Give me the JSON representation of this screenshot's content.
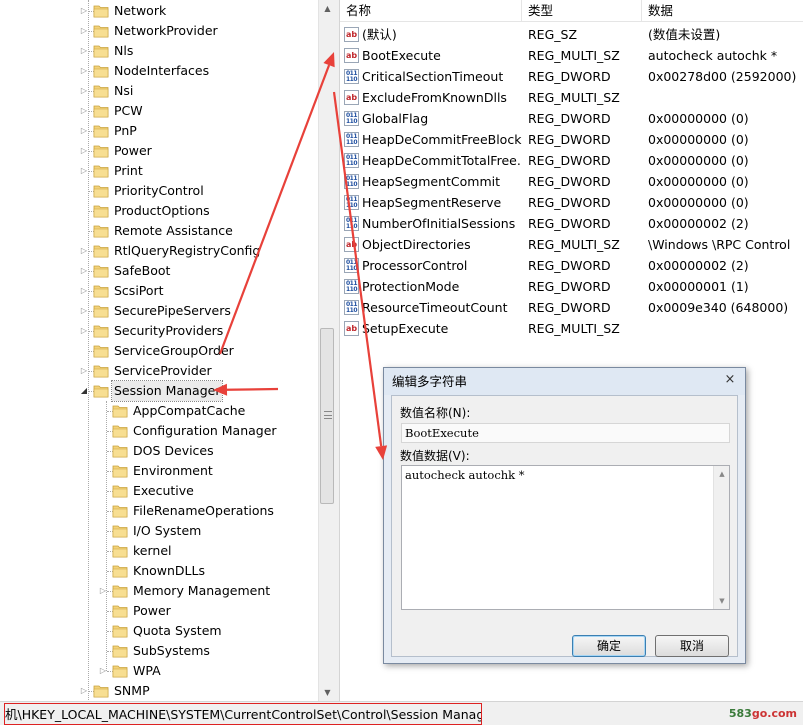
{
  "tree": {
    "items": [
      {
        "label": "Network",
        "level": 0,
        "expander": "collapsed"
      },
      {
        "label": "NetworkProvider",
        "level": 0,
        "expander": "collapsed"
      },
      {
        "label": "Nls",
        "level": 0,
        "expander": "collapsed"
      },
      {
        "label": "NodeInterfaces",
        "level": 0,
        "expander": "collapsed"
      },
      {
        "label": "Nsi",
        "level": 0,
        "expander": "collapsed"
      },
      {
        "label": "PCW",
        "level": 0,
        "expander": "collapsed"
      },
      {
        "label": "PnP",
        "level": 0,
        "expander": "collapsed"
      },
      {
        "label": "Power",
        "level": 0,
        "expander": "collapsed"
      },
      {
        "label": "Print",
        "level": 0,
        "expander": "collapsed"
      },
      {
        "label": "PriorityControl",
        "level": 0,
        "expander": "none"
      },
      {
        "label": "ProductOptions",
        "level": 0,
        "expander": "none"
      },
      {
        "label": "Remote Assistance",
        "level": 0,
        "expander": "none"
      },
      {
        "label": "RtlQueryRegistryConfig",
        "level": 0,
        "expander": "collapsed"
      },
      {
        "label": "SafeBoot",
        "level": 0,
        "expander": "collapsed"
      },
      {
        "label": "ScsiPort",
        "level": 0,
        "expander": "collapsed"
      },
      {
        "label": "SecurePipeServers",
        "level": 0,
        "expander": "collapsed"
      },
      {
        "label": "SecurityProviders",
        "level": 0,
        "expander": "collapsed"
      },
      {
        "label": "ServiceGroupOrder",
        "level": 0,
        "expander": "none"
      },
      {
        "label": "ServiceProvider",
        "level": 0,
        "expander": "collapsed"
      },
      {
        "label": "Session Manager",
        "level": 0,
        "expander": "expanded",
        "selected": true
      },
      {
        "label": "AppCompatCache",
        "level": 1,
        "expander": "none"
      },
      {
        "label": "Configuration Manager",
        "level": 1,
        "expander": "none"
      },
      {
        "label": "DOS Devices",
        "level": 1,
        "expander": "none"
      },
      {
        "label": "Environment",
        "level": 1,
        "expander": "none"
      },
      {
        "label": "Executive",
        "level": 1,
        "expander": "none"
      },
      {
        "label": "FileRenameOperations",
        "level": 1,
        "expander": "none"
      },
      {
        "label": "I/O System",
        "level": 1,
        "expander": "none"
      },
      {
        "label": "kernel",
        "level": 1,
        "expander": "none"
      },
      {
        "label": "KnownDLLs",
        "level": 1,
        "expander": "none"
      },
      {
        "label": "Memory Management",
        "level": 1,
        "expander": "collapsed"
      },
      {
        "label": "Power",
        "level": 1,
        "expander": "none"
      },
      {
        "label": "Quota System",
        "level": 1,
        "expander": "none"
      },
      {
        "label": "SubSystems",
        "level": 1,
        "expander": "none"
      },
      {
        "label": "WPA",
        "level": 1,
        "expander": "collapsed"
      },
      {
        "label": "SNMP",
        "level": 0,
        "expander": "collapsed"
      }
    ]
  },
  "values": {
    "headers": {
      "name": "名称",
      "type": "类型",
      "data": "数据"
    },
    "rows": [
      {
        "icon": "ab",
        "name": "(默认)",
        "type": "REG_SZ",
        "data": "(数值未设置)"
      },
      {
        "icon": "ab",
        "name": "BootExecute",
        "type": "REG_MULTI_SZ",
        "data": "autocheck autochk *"
      },
      {
        "icon": "bin",
        "name": "CriticalSectionTimeout",
        "type": "REG_DWORD",
        "data": "0x00278d00 (2592000)"
      },
      {
        "icon": "ab",
        "name": "ExcludeFromKnownDlls",
        "type": "REG_MULTI_SZ",
        "data": ""
      },
      {
        "icon": "bin",
        "name": "GlobalFlag",
        "type": "REG_DWORD",
        "data": "0x00000000 (0)"
      },
      {
        "icon": "bin",
        "name": "HeapDeCommitFreeBlock...",
        "type": "REG_DWORD",
        "data": "0x00000000 (0)"
      },
      {
        "icon": "bin",
        "name": "HeapDeCommitTotalFree...",
        "type": "REG_DWORD",
        "data": "0x00000000 (0)"
      },
      {
        "icon": "bin",
        "name": "HeapSegmentCommit",
        "type": "REG_DWORD",
        "data": "0x00000000 (0)"
      },
      {
        "icon": "bin",
        "name": "HeapSegmentReserve",
        "type": "REG_DWORD",
        "data": "0x00000000 (0)"
      },
      {
        "icon": "bin",
        "name": "NumberOfInitialSessions",
        "type": "REG_DWORD",
        "data": "0x00000002 (2)"
      },
      {
        "icon": "ab",
        "name": "ObjectDirectories",
        "type": "REG_MULTI_SZ",
        "data": "\\Windows \\RPC Control"
      },
      {
        "icon": "bin",
        "name": "ProcessorControl",
        "type": "REG_DWORD",
        "data": "0x00000002 (2)"
      },
      {
        "icon": "bin",
        "name": "ProtectionMode",
        "type": "REG_DWORD",
        "data": "0x00000001 (1)"
      },
      {
        "icon": "bin",
        "name": "ResourceTimeoutCount",
        "type": "REG_DWORD",
        "data": "0x0009e340 (648000)"
      },
      {
        "icon": "ab",
        "name": "SetupExecute",
        "type": "REG_MULTI_SZ",
        "data": ""
      }
    ]
  },
  "dialog": {
    "title": "编辑多字符串",
    "close_label": "×",
    "name_label": "数值名称(N):",
    "name_value": "BootExecute",
    "data_label": "数值数据(V):",
    "data_value": "autocheck autochk *",
    "ok_label": "确定",
    "cancel_label": "取消"
  },
  "status": {
    "path": "机\\HKEY_LOCAL_MACHINE\\SYSTEM\\CurrentControlSet\\Control\\Session Manager",
    "watermark_a": "583",
    "watermark_b": "go.com"
  },
  "colors": {
    "annotation": "#e8413a",
    "folder": "#e9c46a",
    "highlight_box": "#dd2222"
  }
}
